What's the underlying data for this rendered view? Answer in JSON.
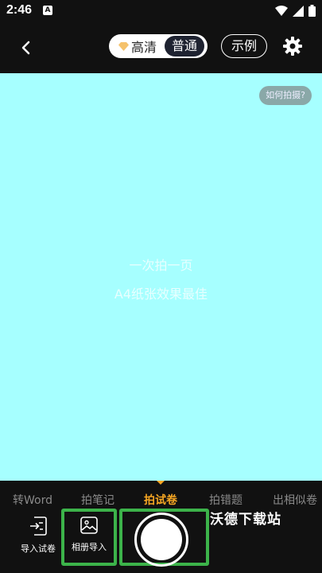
{
  "status_bar": {
    "time": "2:46",
    "notif_icon": "A"
  },
  "top_bar": {
    "quality": {
      "hd_label": "高清",
      "normal_label": "普通"
    },
    "example_label": "示例"
  },
  "viewfinder": {
    "background": "#a6ffff",
    "howto_label": "如何拍摄?",
    "hint_line1": "一次拍一页",
    "hint_line2": "A4纸张效果最佳"
  },
  "modes": {
    "items": [
      {
        "label": "转Word",
        "active": false
      },
      {
        "label": "拍笔记",
        "active": false
      },
      {
        "label": "拍试卷",
        "active": true
      },
      {
        "label": "拍错题",
        "active": false
      },
      {
        "label": "出相似卷",
        "active": false
      }
    ],
    "active_color": "#f5a623"
  },
  "tools": {
    "import_paper_label": "导入试卷",
    "album_import_label": "相册导入"
  },
  "watermark": "沃德下载站",
  "highlight_color": "#3cb34a"
}
